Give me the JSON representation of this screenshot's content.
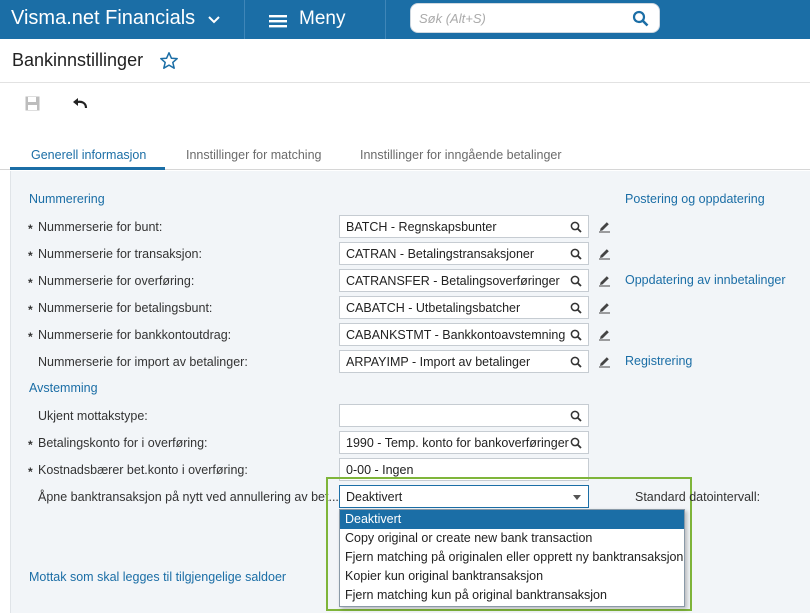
{
  "app": {
    "title": "Visma.net Financials",
    "menu_label": "Meny"
  },
  "search": {
    "placeholder": "Søk (Alt+S)"
  },
  "page": {
    "title": "Bankinnstillinger"
  },
  "tabs": [
    {
      "label": "Generell informasjon",
      "active": true
    },
    {
      "label": "Innstillinger for matching",
      "active": false
    },
    {
      "label": "Innstillinger for inngående betalinger",
      "active": false
    }
  ],
  "sections": {
    "numbering": "Nummerering",
    "reconciliation": "Avstemming",
    "receipts": "Mottak som skal legges til tilgjengelige saldoer"
  },
  "numbering_fields": [
    {
      "label": "Nummerserie for bunt:",
      "required": true,
      "value": "BATCH - Regnskapsbunter"
    },
    {
      "label": "Nummerserie for transaksjon:",
      "required": true,
      "value": "CATRAN - Betalingstransaksjoner"
    },
    {
      "label": "Nummerserie for overføring:",
      "required": true,
      "value": "CATRANSFER - Betalingsoverføringer"
    },
    {
      "label": "Nummerserie for betalingsbunt:",
      "required": true,
      "value": "CABATCH - Utbetalingsbatcher"
    },
    {
      "label": "Nummerserie for bankkontoutdrag:",
      "required": true,
      "value": "CABANKSTMT - Bankkontoavstemning"
    },
    {
      "label": "Nummerserie for import av betalinger:",
      "required": false,
      "value": "ARPAYIMP - Import av betalinger"
    }
  ],
  "reconciliation_fields": [
    {
      "label": "Ukjent mottakstype:",
      "required": false,
      "value": ""
    },
    {
      "label": "Betalingskonto for i overføring:",
      "required": true,
      "value": "1990 - Temp. konto for bankoverføringer"
    },
    {
      "label": "Kostnadsbærer bet.konto i overføring:",
      "required": true,
      "value": "0-00 - Ingen"
    }
  ],
  "reopen_field": {
    "label": "Åpne banktransaksjon på nytt ved annullering av bet...",
    "value": "Deaktivert",
    "options": [
      "Deaktivert",
      "Copy original or create new bank transaction",
      "Fjern matching på originalen eller opprett ny banktransaksjon",
      "Kopier kun original banktransaksjon",
      "Fjern matching kun på original banktransaksjon"
    ]
  },
  "right_links": {
    "posting": "Postering og oppdatering",
    "payment_update": "Oppdatering av innbetalinger",
    "registration": "Registrering",
    "date_interval": "Standard datointervall:"
  },
  "colors": {
    "brand": "#1b6ea6",
    "highlight": "#7fb53a"
  }
}
